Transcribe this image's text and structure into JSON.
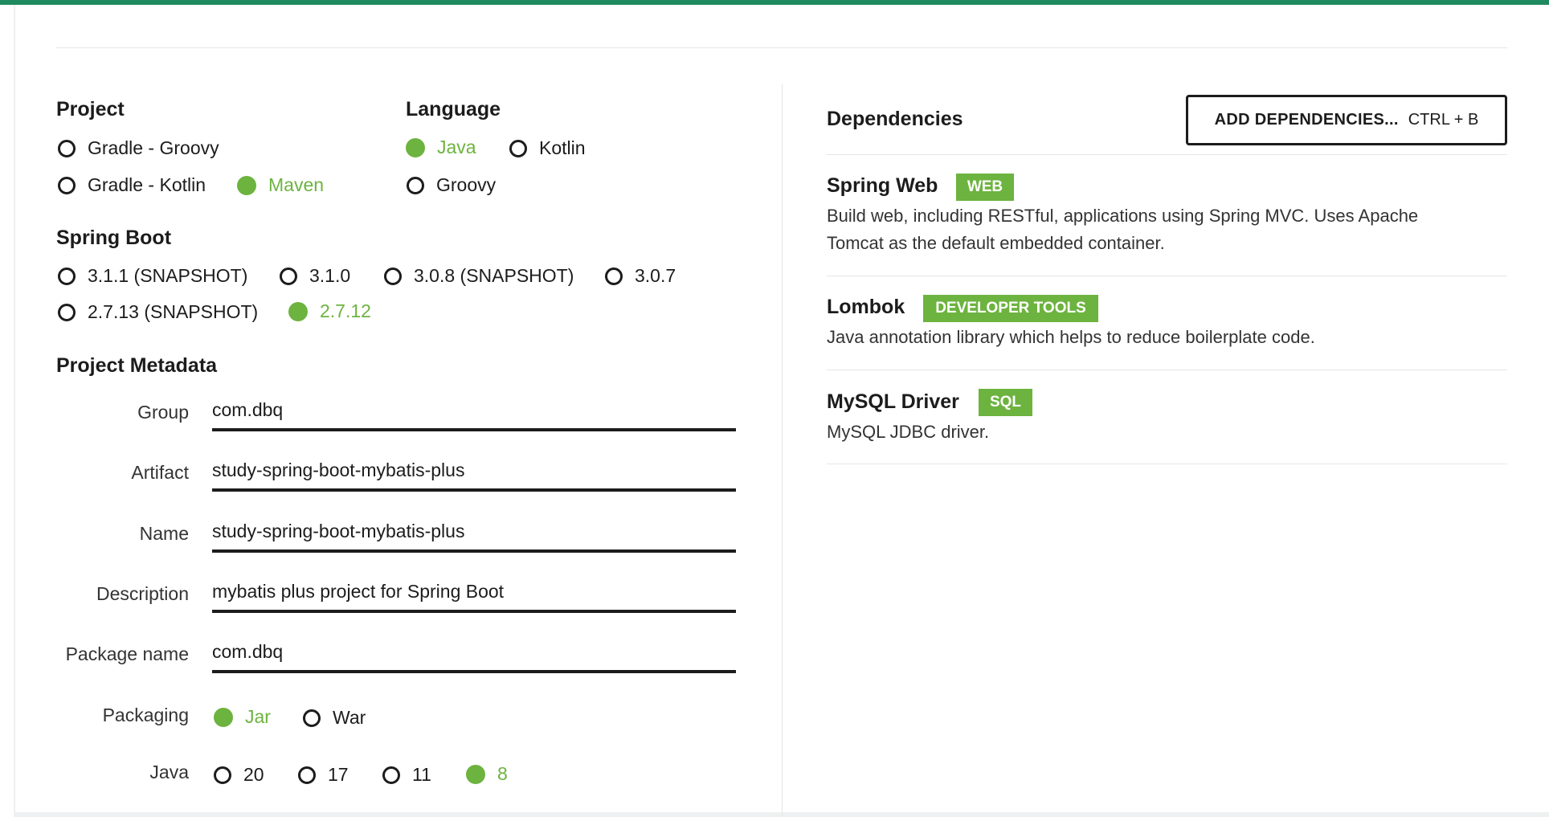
{
  "project": {
    "title": "Project",
    "options": [
      {
        "label": "Gradle - Groovy",
        "selected": false
      },
      {
        "label": "Gradle - Kotlin",
        "selected": false
      },
      {
        "label": "Maven",
        "selected": true
      }
    ]
  },
  "language": {
    "title": "Language",
    "options": [
      {
        "label": "Java",
        "selected": true
      },
      {
        "label": "Kotlin",
        "selected": false
      },
      {
        "label": "Groovy",
        "selected": false
      }
    ]
  },
  "spring_boot": {
    "title": "Spring Boot",
    "options": [
      {
        "label": "3.1.1 (SNAPSHOT)",
        "selected": false
      },
      {
        "label": "3.1.0",
        "selected": false
      },
      {
        "label": "3.0.8 (SNAPSHOT)",
        "selected": false
      },
      {
        "label": "3.0.7",
        "selected": false
      },
      {
        "label": "2.7.13 (SNAPSHOT)",
        "selected": false
      },
      {
        "label": "2.7.12",
        "selected": true
      }
    ]
  },
  "metadata": {
    "title": "Project Metadata",
    "fields": {
      "group": {
        "label": "Group",
        "value": "com.dbq"
      },
      "artifact": {
        "label": "Artifact",
        "value": "study-spring-boot-mybatis-plus"
      },
      "name": {
        "label": "Name",
        "value": "study-spring-boot-mybatis-plus"
      },
      "description": {
        "label": "Description",
        "value": "mybatis plus project for Spring Boot"
      },
      "package_name": {
        "label": "Package name",
        "value": "com.dbq"
      }
    },
    "packaging": {
      "label": "Packaging",
      "options": [
        {
          "label": "Jar",
          "selected": true
        },
        {
          "label": "War",
          "selected": false
        }
      ]
    },
    "java": {
      "label": "Java",
      "options": [
        {
          "label": "20",
          "selected": false
        },
        {
          "label": "17",
          "selected": false
        },
        {
          "label": "11",
          "selected": false
        },
        {
          "label": "8",
          "selected": true
        }
      ]
    }
  },
  "dependencies": {
    "title": "Dependencies",
    "add_button": {
      "label": "ADD DEPENDENCIES...",
      "shortcut": "CTRL + B"
    },
    "items": [
      {
        "name": "Spring Web",
        "badge": "WEB",
        "description": "Build web, including RESTful, applications using Spring MVC. Uses Apache Tomcat as the default embedded container."
      },
      {
        "name": "Lombok",
        "badge": "DEVELOPER TOOLS",
        "description": "Java annotation library which helps to reduce boilerplate code."
      },
      {
        "name": "MySQL Driver",
        "badge": "SQL",
        "description": "MySQL JDBC driver."
      }
    ]
  },
  "colors": {
    "accent": "#6db33f",
    "top_bar": "#1f8a5f",
    "text": "#1c1c1c"
  }
}
